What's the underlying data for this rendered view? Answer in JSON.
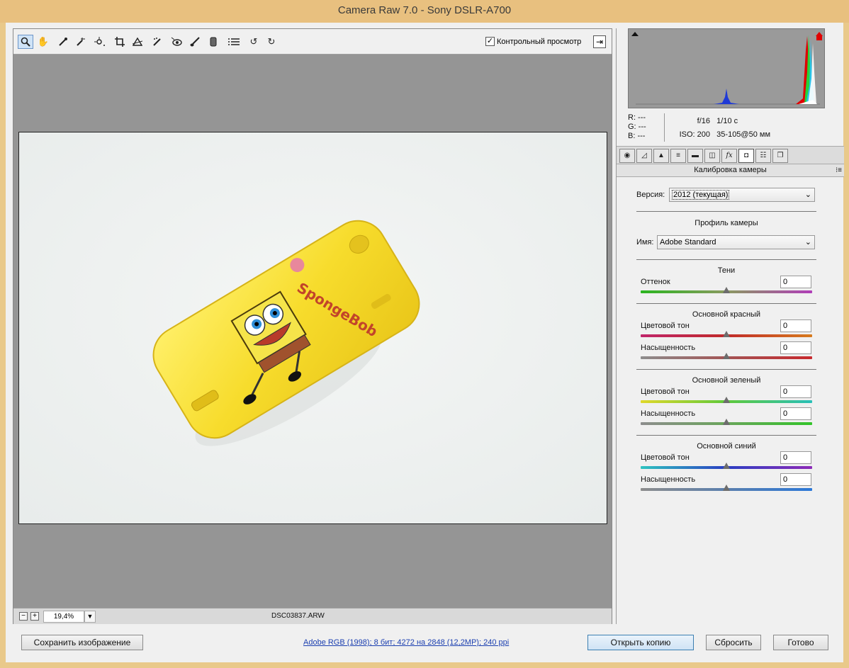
{
  "window": {
    "title": "Camera Raw 7.0  -  Sony DSLR-A700"
  },
  "toolbar": {
    "tools": [
      {
        "name": "zoom-tool-icon",
        "glyph": "🔍"
      },
      {
        "name": "hand-tool-icon",
        "glyph": "✋"
      },
      {
        "name": "white-balance-tool-icon",
        "glyph": "✎"
      },
      {
        "name": "color-sampler-tool-icon",
        "glyph": "✐"
      },
      {
        "name": "targeted-adjustment-tool-icon",
        "glyph": "⊙"
      },
      {
        "name": "crop-tool-icon",
        "glyph": "⌗"
      },
      {
        "name": "straighten-tool-icon",
        "glyph": "△"
      },
      {
        "name": "spot-removal-tool-icon",
        "glyph": "✂"
      },
      {
        "name": "red-eye-tool-icon",
        "glyph": "◉"
      },
      {
        "name": "adjustment-brush-icon",
        "glyph": "🖌"
      },
      {
        "name": "graduated-filter-icon",
        "glyph": "▮"
      },
      {
        "name": "preferences-icon",
        "glyph": "☰"
      },
      {
        "name": "rotate-left-icon",
        "glyph": "↺"
      },
      {
        "name": "rotate-right-icon",
        "glyph": "↻"
      }
    ],
    "preview_label": "Контрольный просмотр",
    "preview_checked": true
  },
  "status": {
    "zoom": "19,4%",
    "filename": "DSC03837.ARW"
  },
  "info": {
    "r": "R:   ---",
    "g": "G:   ---",
    "b": "B:   ---",
    "aperture": "f/16",
    "shutter": "1/10 с",
    "iso": "ISO: 200",
    "lens": "35-105@50 мм"
  },
  "panel": {
    "tabs": [
      "basic-tab",
      "tone-curve-tab",
      "detail-tab",
      "hsl-tab",
      "split-toning-tab",
      "lens-corrections-tab",
      "effects-tab",
      "camera-calibration-tab",
      "presets-tab",
      "snapshots-tab"
    ],
    "title": "Калибровка камеры",
    "version_label": "Версия:",
    "version_value": "2012 (текущая)",
    "profile_heading": "Профиль камеры",
    "name_label": "Имя:",
    "name_value": "Adobe Standard",
    "shadows": {
      "heading": "Тени",
      "tint_label": "Оттенок",
      "tint_value": "0"
    },
    "red": {
      "heading": "Основной красный",
      "hue_label": "Цветовой тон",
      "hue_value": "0",
      "sat_label": "Насыщенность",
      "sat_value": "0"
    },
    "green": {
      "heading": "Основной зеленый",
      "hue_label": "Цветовой тон",
      "hue_value": "0",
      "sat_label": "Насыщенность",
      "sat_value": "0"
    },
    "blue": {
      "heading": "Основной синий",
      "hue_label": "Цветовой тон",
      "hue_value": "0",
      "sat_label": "Насыщенность",
      "sat_value": "0"
    }
  },
  "footer": {
    "save_label": "Сохранить изображение",
    "workflow_link": "Adobe RGB (1998); 8 бит; 4272 на 2848 (12,2MP); 240 ppi",
    "open_copy_label": "Открыть копию",
    "reset_label": "Сбросить",
    "done_label": "Готово"
  },
  "photo_text": {
    "brand": "SpongeBob"
  }
}
